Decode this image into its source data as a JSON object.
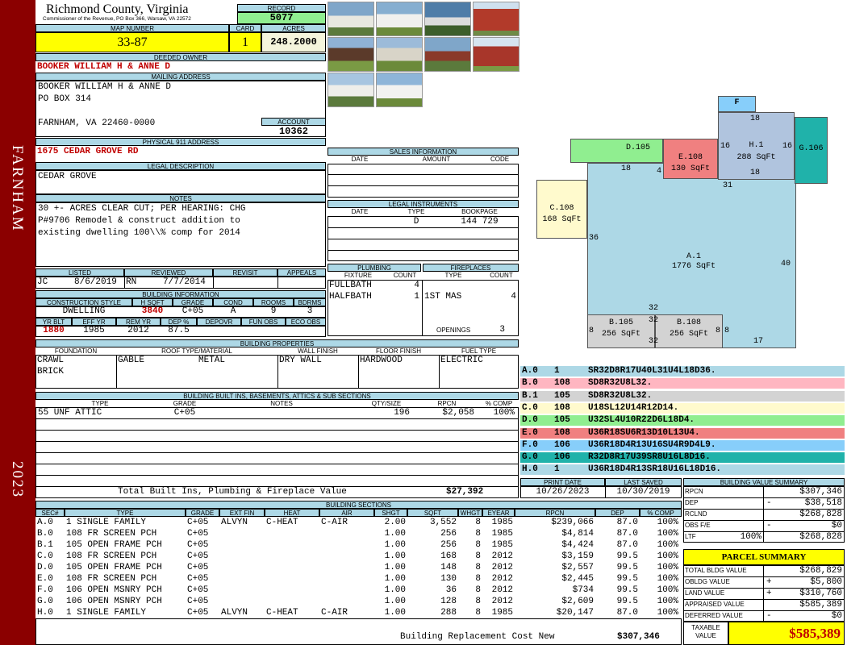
{
  "sidebar": {
    "district": "FARNHAM",
    "year": "2023"
  },
  "header": {
    "county": "Richmond County, Virginia",
    "commissioner": "Commissioner of the Revenue, PO Box 366, Warsaw, VA 22572",
    "record_label": "RECORD",
    "record": "5077"
  },
  "map": {
    "map_label": "MAP NUMBER",
    "map_number": "33-87",
    "card_label": "CARD",
    "card": "1",
    "acres_label": "ACRES",
    "acres": "248.2000"
  },
  "owner": {
    "deeded_label": "DEEDED OWNER",
    "deeded_owner": "BOOKER WILLIAM H & ANNE D",
    "mailing_label": "MAILING ADDRESS",
    "mail_line1": "BOOKER WILLIAM H & ANNE D",
    "mail_line2": "PO BOX 314",
    "mail_line3": "FARNHAM, VA 22460-0000",
    "account_label": "ACCOUNT",
    "account": "10362"
  },
  "address": {
    "label": "PHYSICAL 911 ADDRESS",
    "value": "1675 CEDAR GROVE RD"
  },
  "legal": {
    "label": "LEGAL DESCRIPTION",
    "value": "CEDAR GROVE"
  },
  "notes": {
    "label": "NOTES",
    "line1": "30 +- ACRES CLEAR CUT; PER HEARING: CHG",
    "line2": "P#9706 Remodel & construct addition to",
    "line3": "existing dwelling 100\\\\% comp for 2014"
  },
  "listing": {
    "listed_label": "LISTED",
    "reviewed_label": "REVIEWED",
    "revisit_label": "REVISIT",
    "appeals_label": "APPEALS",
    "listed_by": "JC",
    "listed_date": "8/6/2019",
    "reviewed_by": "RN",
    "reviewed_date": "7/7/2014"
  },
  "building_info": {
    "label": "BUILDING INFORMATION",
    "h_construction": "CONSTRUCTION STYLE",
    "h_sqft": "H SQFT",
    "h_grade": "GRADE",
    "h_cond": "COND",
    "h_rooms": "ROOMS",
    "h_bdrms": "BDRMS",
    "construction": "DWELLING",
    "sqft": "3840",
    "grade": "C+05",
    "cond": "A",
    "rooms": "9",
    "bdrms": "3",
    "h_yrblt": "YR BLT",
    "h_effyr": "EFF YR",
    "h_remyr": "REM YR",
    "h_dep": "DEP %",
    "h_depovr": "DEPOVR",
    "h_funobs": "FUN OBS",
    "h_ecoobs": "ECO OBS",
    "yrblt": "1880",
    "effyr": "1985",
    "remyr": "2012",
    "dep": "87.5"
  },
  "sales": {
    "label": "SALES INFORMATION",
    "h_date": "DATE",
    "h_amount": "AMOUNT",
    "h_code": "CODE"
  },
  "legal_instruments": {
    "label": "LEGAL INSTRUMENTS",
    "h_date": "DATE",
    "h_type": "TYPE",
    "h_bookpage": "BOOKPAGE",
    "type": "D",
    "bookpage": "144 729"
  },
  "plumbing": {
    "label": "PLUMBING",
    "h_fixture": "FIXTURE",
    "h_count": "COUNT",
    "rows": [
      {
        "fixture": "FULLBATH",
        "count": "4"
      },
      {
        "fixture": "HALFBATH",
        "count": "1"
      }
    ]
  },
  "fireplaces": {
    "label": "FIREPLACES",
    "h_type": "TYPE",
    "h_count": "COUNT",
    "type": "1ST MAS",
    "count": "4",
    "openings_label": "OPENINGS",
    "openings": "3"
  },
  "properties": {
    "label": "BUILDING PROPERTIES",
    "h_foundation": "FOUNDATION",
    "h_roof": "ROOF TYPE/MATERIAL",
    "h_wall": "WALL FINISH",
    "h_floor": "FLOOR FINISH",
    "h_fuel": "FUEL TYPE",
    "foundation1": "CRAWL",
    "foundation2": "BRICK",
    "roof_type": "GABLE",
    "roof_material": "METAL",
    "wall": "DRY WALL",
    "floor": "HARDWOOD",
    "fuel": "ELECTRIC"
  },
  "builtins": {
    "label": "BUILDING BUILT INS, BASEMENTS, ATTICS & SUB SECTIONS",
    "h_type": "TYPE",
    "h_grade": "GRADE",
    "h_notes": "NOTES",
    "h_qty": "QTY/SIZE",
    "h_rpcn": "RPCN",
    "h_comp": "% COMP",
    "type": "55 UNF ATTIC",
    "grade": "C+05",
    "qty": "196",
    "rpcn": "$2,058",
    "comp": "100%",
    "total_label": "Total Built Ins, Plumbing & Fireplace Value",
    "total": "$27,392"
  },
  "print": {
    "print_label": "PRINT DATE",
    "saved_label": "LAST SAVED",
    "print_date": "10/26/2023",
    "saved_date": "10/30/2019"
  },
  "sections": {
    "label": "BUILDING SECTIONS",
    "headers": [
      "SEC#",
      "TYPE",
      "GRADE",
      "EXT FIN",
      "HEAT",
      "AIR",
      "SHGT",
      "SQFT",
      "WHGT",
      "EYEAR",
      "RPCN",
      "DEP",
      "% COMP"
    ],
    "rows": [
      [
        "A.0",
        "1 SINGLE FAMILY",
        "C+05",
        "ALVYN",
        "C-HEAT",
        "C-AIR",
        "2.00",
        "3,552",
        "8",
        "1985",
        "$239,066",
        "87.0",
        "100%"
      ],
      [
        "B.0",
        "108 FR SCREEN PCH",
        "C+05",
        "",
        "",
        "",
        "1.00",
        "256",
        "8",
        "1985",
        "$4,814",
        "87.0",
        "100%"
      ],
      [
        "B.1",
        "105 OPEN FRAME PCH",
        "C+05",
        "",
        "",
        "",
        "1.00",
        "256",
        "8",
        "1985",
        "$4,424",
        "87.0",
        "100%"
      ],
      [
        "C.0",
        "108 FR SCREEN PCH",
        "C+05",
        "",
        "",
        "",
        "1.00",
        "168",
        "8",
        "2012",
        "$3,159",
        "99.5",
        "100%"
      ],
      [
        "D.0",
        "105 OPEN FRAME PCH",
        "C+05",
        "",
        "",
        "",
        "1.00",
        "148",
        "8",
        "2012",
        "$2,557",
        "99.5",
        "100%"
      ],
      [
        "E.0",
        "108 FR SCREEN PCH",
        "C+05",
        "",
        "",
        "",
        "1.00",
        "130",
        "8",
        "2012",
        "$2,445",
        "99.5",
        "100%"
      ],
      [
        "F.0",
        "106 OPEN MSNRY PCH",
        "C+05",
        "",
        "",
        "",
        "1.00",
        "36",
        "8",
        "2012",
        "$734",
        "99.5",
        "100%"
      ],
      [
        "G.0",
        "106 OPEN MSNRY PCH",
        "C+05",
        "",
        "",
        "",
        "1.00",
        "128",
        "8",
        "2012",
        "$2,609",
        "99.5",
        "100%"
      ],
      [
        "H.0",
        "1 SINGLE FAMILY",
        "C+05",
        "ALVYN",
        "C-HEAT",
        "C-AIR",
        "1.00",
        "288",
        "8",
        "1985",
        "$20,147",
        "87.0",
        "100%"
      ]
    ],
    "replacement_label": "Building Replacement Cost New",
    "replacement": "$307,346"
  },
  "sketch": {
    "a": {
      "name": "A.1",
      "area": "1776 SqFt"
    },
    "b1": {
      "name": "B.105",
      "area": "256 SqFt"
    },
    "b2": {
      "name": "B.108",
      "area": "256 SqFt"
    },
    "c": {
      "name": "C.108",
      "area": "168 SqFt"
    },
    "d": {
      "name": "D.105"
    },
    "e": {
      "name": "E.108",
      "area": "130 SqFt"
    },
    "f": {
      "name": "F"
    },
    "g": {
      "name": "G.106"
    },
    "h": {
      "name": "H.1",
      "area": "288 SqFt"
    },
    "dims": {
      "d18": "18",
      "d4": "4",
      "h18top": "18",
      "h16l": "16",
      "h16r": "16",
      "h18b": "18",
      "d31": "31",
      "d36": "36",
      "d40": "40",
      "d32a": "32",
      "d32b": "32",
      "d32c": "32",
      "d8a": "8",
      "d8b": "8",
      "d8c": "8",
      "d17": "17"
    }
  },
  "vectors": [
    {
      "id": "A.0",
      "code": "1",
      "vec": "SR32D8R17U40L31U4L18D36.",
      "color": "#add8e6"
    },
    {
      "id": "B.0",
      "code": "108",
      "vec": "SD8R32U8L32.",
      "color": "#ffb6c1"
    },
    {
      "id": "B.1",
      "code": "105",
      "vec": "SD8R32U8L32.",
      "color": "#d3d3d3"
    },
    {
      "id": "C.0",
      "code": "108",
      "vec": "U18SL12U14R12D14.",
      "color": "#fffacd"
    },
    {
      "id": "D.0",
      "code": "105",
      "vec": "U32SL4U10R22D6L18D4.",
      "color": "#90ee90"
    },
    {
      "id": "E.0",
      "code": "108",
      "vec": "U36R18SU6R13D10L13U4.",
      "color": "#f08080"
    },
    {
      "id": "F.0",
      "code": "106",
      "vec": "U36R18D4R13U16SU4R9D4L9.",
      "color": "#87cefa"
    },
    {
      "id": "G.0",
      "code": "106",
      "vec": "R32D8R17U39SR8U16L8D16.",
      "color": "#20b2aa"
    },
    {
      "id": "H.0",
      "code": "1",
      "vec": "U36R18D4R13SR18U16L18D16.",
      "color": "#add8e6"
    }
  ],
  "bvs": {
    "label": "BUILDING VALUE SUMMARY",
    "rpcn_label": "RPCN",
    "rpcn": "$307,346",
    "dep_label": "DEP",
    "dep_sign": "-",
    "dep": "$38,518",
    "rclnd_label": "RCLND",
    "rclnd": "$268,828",
    "obs_label": "OBS F/E",
    "obs_sign": "-",
    "obs": "$0",
    "ltf_label": "LTF",
    "ltf_pct": "100%",
    "ltf": "$268,828"
  },
  "parcel": {
    "label": "PARCEL SUMMARY",
    "bldg_label": "TOTAL BLDG VALUE",
    "bldg": "$268,829",
    "obldg_label": "OBLDG VALUE",
    "obldg_sign": "+",
    "obldg": "$5,800",
    "land_label": "LAND VALUE",
    "land_sign": "+",
    "land": "$310,760",
    "appraised_label": "APPRAISED VALUE",
    "appraised": "$585,389",
    "deferred_label": "DEFERRED VALUE",
    "deferred_sign": "-",
    "deferred": "$0",
    "taxable_label1": "TAXABLE",
    "taxable_label2": "VALUE",
    "taxable": "$585,389"
  }
}
